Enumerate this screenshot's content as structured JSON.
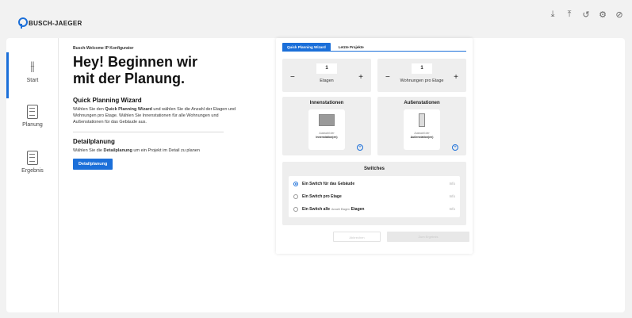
{
  "brand": {
    "name": "BUSCH-JAEGER",
    "color": "#1b6fd9"
  },
  "topbar": {
    "icons": [
      "download-icon",
      "upload-icon",
      "undo-icon",
      "settings-icon",
      "help-icon"
    ]
  },
  "sidebar": {
    "items": [
      {
        "label": "Start",
        "icon": "sliders-icon",
        "active": true
      },
      {
        "label": "Planung",
        "icon": "document-icon",
        "active": false
      },
      {
        "label": "Ergebnis",
        "icon": "result-icon",
        "active": false
      }
    ]
  },
  "intro": {
    "kicker": "Busch-Welcome IP Konfigurator",
    "heading_line1": "Hey! Beginnen wir",
    "heading_line2": "mit der Planung.",
    "wizard_title": "Quick Planning Wizard",
    "wizard_text_pre": "Wählen Sie den ",
    "wizard_text_bold": "Quick Planning Wizard",
    "wizard_text_post": " und wählen Sie die Anzahl der Etagen und Wohnungen pro Etage. Wählen Sie Innenstationen für alle Wohnungen und Außenstationen für das Gebäude aus.",
    "detail_title": "Detailplanung",
    "detail_text_pre": "Wählen Sie die ",
    "detail_text_bold": "Detailplanung",
    "detail_text_post": " um ein Projekt im Detail zu planen",
    "detail_button": "Detailplanung"
  },
  "wizard": {
    "tabs": [
      {
        "label": "Quick Planning Wizard",
        "active": true
      },
      {
        "label": "Letzte Projekte",
        "active": false
      }
    ],
    "floors": {
      "value": "1",
      "label": "Etagen"
    },
    "apartments": {
      "value": "1",
      "label": "Wohnungen pro Etage"
    },
    "indoor": {
      "title": "Innenstationen",
      "sub": "Auswahl der",
      "main": "Innenstation(en)"
    },
    "outdoor": {
      "title": "Außenstationen",
      "sub": "Auswahl der",
      "main": "Außenstation(en)"
    },
    "switches": {
      "title": "Switches",
      "info_label": "Info",
      "opt1_pre": "Ein Switch für das Gebäude",
      "opt2_pre": "Ein Switch pro Etage",
      "opt3_a": "Ein Switch alle",
      "opt3_small": "Anzahl Etagen",
      "opt3_b": "Etagen"
    },
    "button_back": "Abbrechen",
    "button_result": "Zum Ergebnis"
  }
}
